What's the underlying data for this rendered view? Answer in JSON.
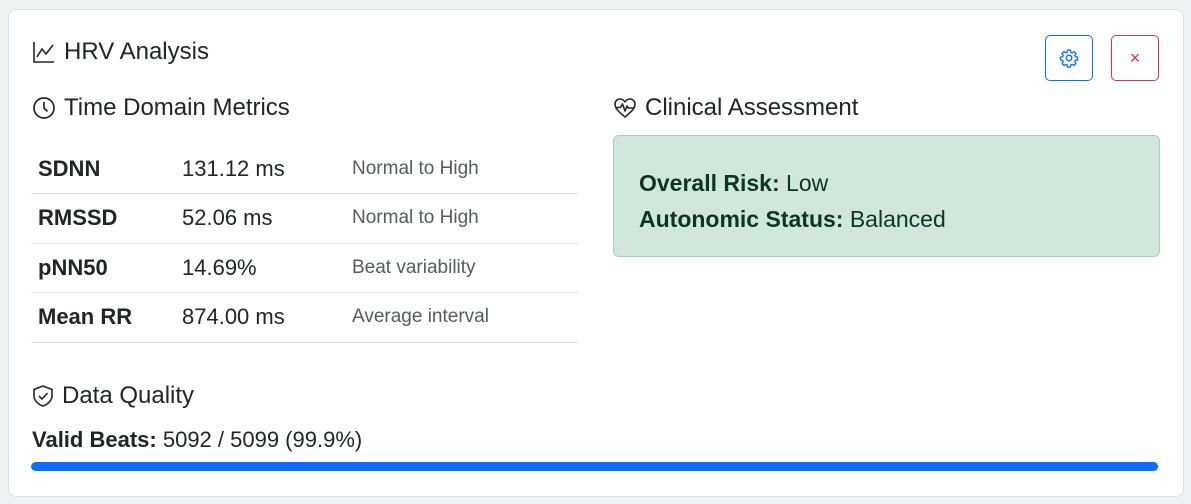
{
  "header": {
    "title": "HRV Analysis",
    "icon": "graph-line-icon"
  },
  "buttons": {
    "settings_icon": "gear-icon",
    "close_label": "×"
  },
  "time_domain": {
    "heading": "Time Domain Metrics",
    "icon": "clock-icon",
    "rows": [
      {
        "name": "SDNN",
        "value": "131.12 ms",
        "note": "Normal to High"
      },
      {
        "name": "RMSSD",
        "value": "52.06 ms",
        "note": "Normal to High"
      },
      {
        "name": "pNN50",
        "value": "14.69%",
        "note": "Beat variability"
      },
      {
        "name": "Mean RR",
        "value": "874.00 ms",
        "note": "Average interval"
      }
    ]
  },
  "clinical": {
    "heading": "Clinical Assessment",
    "icon": "heart-pulse-icon",
    "overall_risk_label": "Overall Risk:",
    "overall_risk_value": "Low",
    "autonomic_label": "Autonomic Status:",
    "autonomic_value": "Balanced"
  },
  "data_quality": {
    "heading": "Data Quality",
    "icon": "shield-check-icon",
    "valid_label": "Valid Beats:",
    "valid_value": "5092 / 5099 (99.9%)",
    "progress_fraction": 0.999
  },
  "colors": {
    "accent": "#0d6efd",
    "danger": "#dc3545",
    "success_bg": "#d1e7dd",
    "success_text": "#0a3622"
  }
}
